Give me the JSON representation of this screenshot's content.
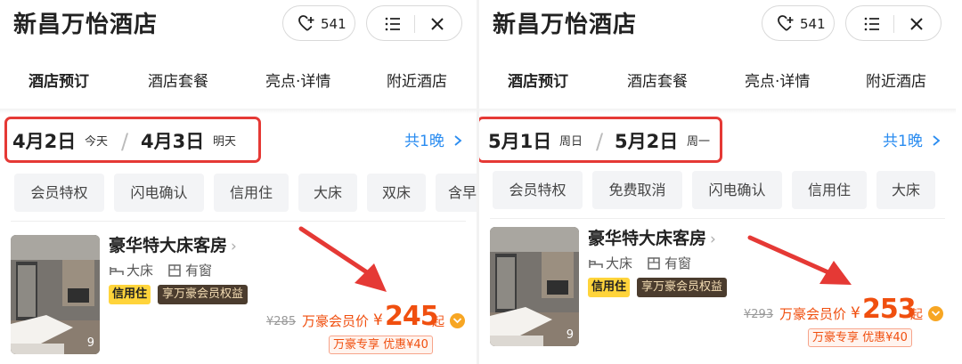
{
  "hotel_name": "新昌万怡酒店",
  "favorites_count": "541",
  "icons": {
    "favorite": "heart-plus-icon",
    "menu": "list-icon",
    "close": "close-icon",
    "bed": "bed-icon",
    "window": "window-icon",
    "chevron": "chevron-right-icon",
    "discount": "chevron-down-badge-icon"
  },
  "colors": {
    "accent_orange": "#f04f0f",
    "tab_highlight": "#ffd43b",
    "link_blue": "#2a8cf0",
    "annotation_red": "#e53935",
    "member_tag_bg": "#4b3c2e"
  },
  "panels": [
    {
      "tabs": [
        "酒店预订",
        "酒店套餐",
        "亮点·详情",
        "附近酒店"
      ],
      "active_tab": "酒店预订",
      "checkin": {
        "date": "4月2日",
        "label": "今天"
      },
      "checkout": {
        "date": "4月3日",
        "label": "明天"
      },
      "nights": "共1晚",
      "chips": [
        "会员特权",
        "闪电确认",
        "信用住",
        "大床",
        "双床",
        "含早"
      ],
      "room": {
        "name": "豪华特大床客房",
        "bed": "大床",
        "window": "有窗",
        "tag_credit": "信用住",
        "tag_member": "享万豪会员权益",
        "photo_count": "9",
        "original_price": "¥285",
        "member_price_label": "万豪会员价",
        "currency": "¥",
        "price": "245",
        "price_suffix": "起",
        "promo": "万豪专享  优惠¥40"
      }
    },
    {
      "tabs": [
        "酒店预订",
        "酒店套餐",
        "亮点·详情",
        "附近酒店"
      ],
      "active_tab": "酒店预订",
      "checkin": {
        "date": "5月1日",
        "label": "周日"
      },
      "checkout": {
        "date": "5月2日",
        "label": "周一"
      },
      "nights": "共1晚",
      "chips": [
        "会员特权",
        "免费取消",
        "闪电确认",
        "信用住",
        "大床"
      ],
      "room": {
        "name": "豪华特大床客房",
        "bed": "大床",
        "window": "有窗",
        "tag_credit": "信用住",
        "tag_member": "享万豪会员权益",
        "photo_count": "9",
        "original_price": "¥293",
        "member_price_label": "万豪会员价",
        "currency": "¥",
        "price": "253",
        "price_suffix": "起",
        "promo": "万豪专享  优惠¥40"
      }
    }
  ]
}
